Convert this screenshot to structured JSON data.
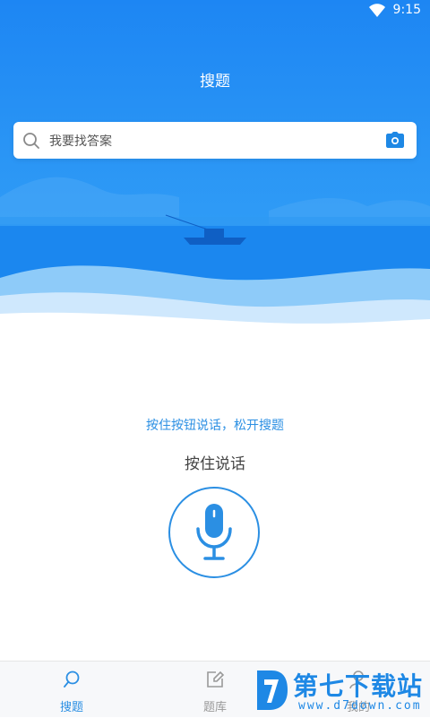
{
  "status_bar": {
    "time": "9:15",
    "wifi_icon": "wifi-icon"
  },
  "header": {
    "title": "搜题"
  },
  "search": {
    "placeholder": "我要找答案",
    "search_icon": "search-icon",
    "camera_icon": "camera-icon"
  },
  "voice": {
    "hint": "按住按钮说话，松开搜题",
    "label": "按住说话",
    "mic_icon": "microphone-icon"
  },
  "tabbar": {
    "tabs": [
      {
        "label": "搜题",
        "icon": "search-icon",
        "active": true
      },
      {
        "label": "题库",
        "icon": "edit-icon",
        "active": false
      },
      {
        "label": "我的",
        "icon": "user-icon",
        "active": false
      }
    ]
  },
  "watermark": {
    "title": "第七下载站",
    "url": "www.d7down.com"
  },
  "colors": {
    "primary": "#2b8fe3",
    "hero_top": "#1d86f3",
    "hero_bottom": "#37a6f7"
  }
}
